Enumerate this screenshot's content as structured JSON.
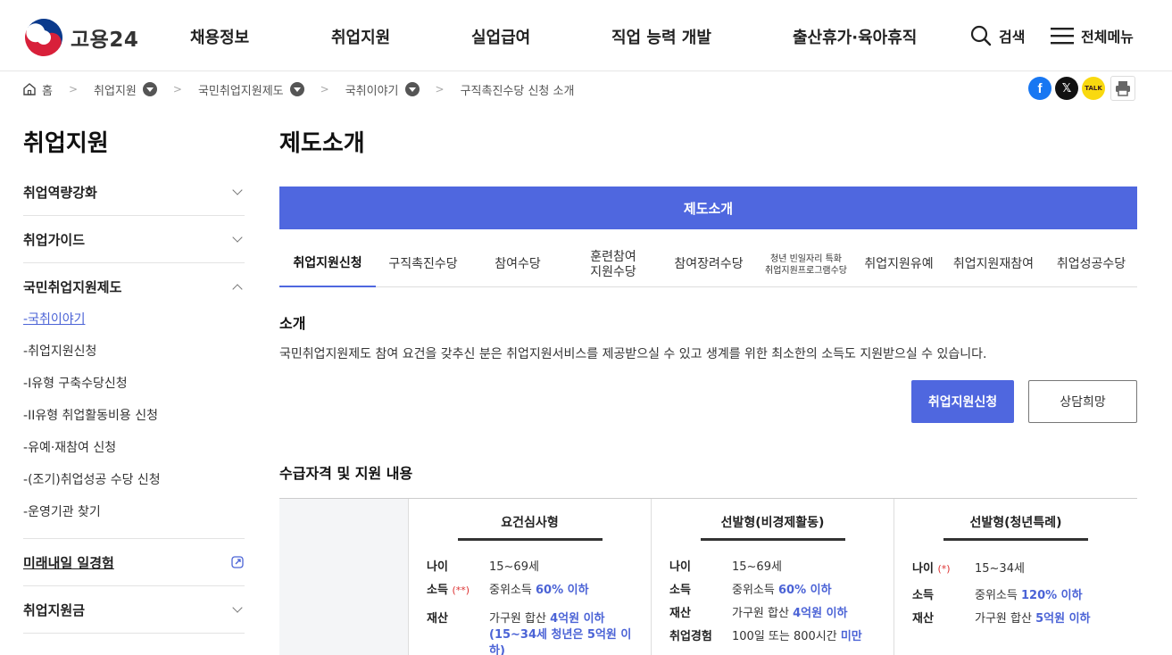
{
  "header": {
    "logo_text": "고용24",
    "nav": [
      "채용정보",
      "취업지원",
      "실업급여",
      "직업 능력 개발",
      "출산휴가·육아휴직"
    ],
    "search_label": "검색",
    "menu_label": "전체메뉴"
  },
  "breadcrumb": {
    "home": "홈",
    "items": [
      "취업지원",
      "국민취업지원제도",
      "국취이야기"
    ],
    "current": "구직촉진수당 신청 소개"
  },
  "share": {
    "facebook": "f",
    "x": "𝕏",
    "kakao": "TALK",
    "print": "print-icon"
  },
  "sidebar": {
    "title": "취업지원",
    "sections": [
      "취업역량강화",
      "취업가이드",
      "국민취업지원제도"
    ],
    "subitems": [
      "국취이야기",
      "취업지원신청",
      "I유형 구축수당신청",
      "II유형 취업활동비용 신청",
      "유예·재참여 신청",
      "(조기)취업성공 수당 신청",
      "운영기관 찾기"
    ],
    "more_sections": [
      "미래내일 일경험",
      "취업지원금"
    ]
  },
  "main": {
    "title": "제도소개",
    "bar_label": "제도소개",
    "tabs": [
      "취업지원신청",
      "구직촉진수당",
      "참여수당",
      "훈련참여\n지원수당",
      "참여장려수당",
      "청년 빈일자리 특화\n취업지원프로그램수당",
      "취업지원유예",
      "취업지원재참여",
      "취업성공수당"
    ],
    "intro_title": "소개",
    "intro_text": "국민취업지원제도 참여 요건을 갖추신 분은 취업지원서비스를 제공받으실 수 있고 생계를 위한 최소한의 소득도 지원받으실 수 있습니다.",
    "apply_button": "취업지원신청",
    "consult_button": "상담희망",
    "eligibility_title": "수급자격 및 지원 내용"
  },
  "table": {
    "columns": [
      {
        "header": "요건심사형",
        "rows": [
          {
            "k": "나이",
            "mark": "",
            "pre": "15~69세",
            "hl": "",
            "post": ""
          },
          {
            "k": "소득",
            "mark": "(**)",
            "pre": "중위소득 ",
            "hl": "60% 이하",
            "post": ""
          },
          {
            "k": "재산",
            "mark": "",
            "pre": "가구원 합산 ",
            "hl": "4억원 이하",
            "post": ""
          }
        ],
        "extra": [
          "(15~34세 청년은 5억원 이",
          "하)"
        ]
      },
      {
        "header": "선발형(비경제활동)",
        "rows": [
          {
            "k": "나이",
            "mark": "",
            "pre": "15~69세",
            "hl": "",
            "post": ""
          },
          {
            "k": "소득",
            "mark": "",
            "pre": "중위소득 ",
            "hl": "60% 이하",
            "post": ""
          },
          {
            "k": "재산",
            "mark": "",
            "pre": "가구원 합산 ",
            "hl": "4억원",
            "post": " 이하"
          },
          {
            "k": "취업경험",
            "mark": "",
            "pre": "100일 또는 800시간 ",
            "hl": "미만",
            "post": ""
          }
        ],
        "extra": []
      },
      {
        "header": "선발형(청년특례)",
        "rows": [
          {
            "k": "나이",
            "mark": "(*)",
            "pre": "15~34세",
            "hl": "",
            "post": ""
          },
          {
            "k": "소득",
            "mark": "",
            "pre": "중위소득 ",
            "hl": "120% 이하",
            "post": ""
          },
          {
            "k": "재산",
            "mark": "",
            "pre": "가구원 합산 ",
            "hl": "5억원 이하",
            "post": ""
          }
        ],
        "extra": []
      }
    ]
  },
  "colors": {
    "accent": "#4f67df",
    "link": "#4b63d6",
    "mark": "#dd3333"
  }
}
